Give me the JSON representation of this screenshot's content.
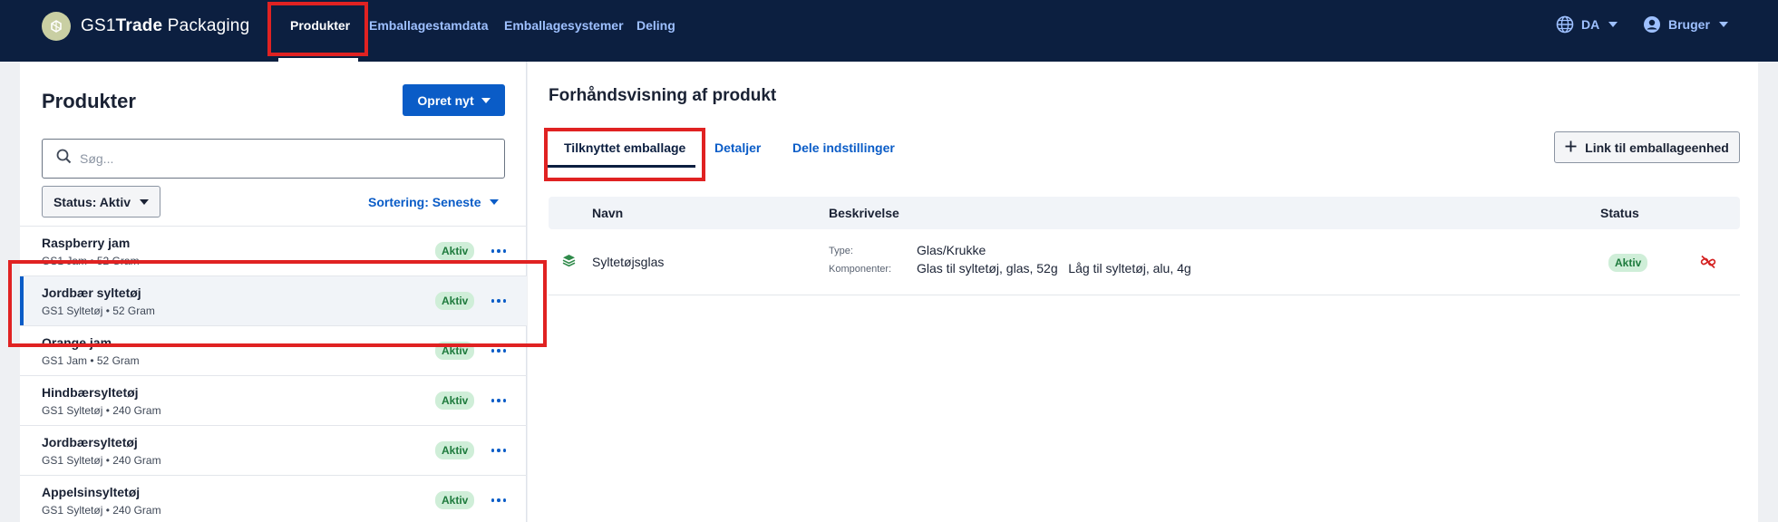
{
  "app": {
    "logo_text_regular1": "GS1",
    "logo_text_bold": "Trade",
    "logo_text_regular2": " Packaging"
  },
  "nav": {
    "items": [
      {
        "label": "Produkter",
        "active": true
      },
      {
        "label": "Emballagestamdata",
        "active": false
      },
      {
        "label": "Emballagesystemer",
        "active": false
      },
      {
        "label": "Deling",
        "active": false
      }
    ],
    "language": "DA",
    "user": "Bruger"
  },
  "products_panel": {
    "title": "Produkter",
    "create_button": "Opret nyt",
    "search_placeholder": "Søg...",
    "status_filter": "Status: Aktiv",
    "sort_label": "Sortering: Seneste",
    "items": [
      {
        "name": "Raspberry jam",
        "sub": "GS1 Jam • 52 Gram",
        "status": "Aktiv",
        "selected": false
      },
      {
        "name": "Jordbær syltetøj",
        "sub": "GS1 Syltetøj • 52 Gram",
        "status": "Aktiv",
        "selected": true
      },
      {
        "name": "Orange jam",
        "sub": "GS1 Jam • 52 Gram",
        "status": "Aktiv",
        "selected": false
      },
      {
        "name": "Hindbærsyltetøj",
        "sub": "GS1 Syltetøj • 240 Gram",
        "status": "Aktiv",
        "selected": false
      },
      {
        "name": "Jordbærsyltetøj",
        "sub": "GS1 Syltetøj • 240 Gram",
        "status": "Aktiv",
        "selected": false
      },
      {
        "name": "Appelsinsyltetøj",
        "sub": "GS1 Syltetøj • 240 Gram",
        "status": "Aktiv",
        "selected": false
      }
    ]
  },
  "preview": {
    "title": "Forhåndsvisning af produkt",
    "tabs": [
      {
        "label": "Tilknyttet emballage",
        "active": true
      },
      {
        "label": "Detaljer",
        "active": false
      },
      {
        "label": "Dele indstillinger",
        "active": false
      }
    ],
    "link_button": "Link til emballageenhed",
    "table": {
      "headers": {
        "name": "Navn",
        "description": "Beskrivelse",
        "status": "Status"
      },
      "rows": [
        {
          "name": "Syltetøjsglas",
          "type_label": "Type:",
          "type_value": "Glas/Krukke",
          "components_label": "Komponenter:",
          "components_value": "Glas til syltetøj, glas, 52g   Låg til syltetøj, alu, 4g",
          "status": "Aktiv"
        }
      ]
    }
  },
  "colors": {
    "topbar": "#0c1f40",
    "primary": "#0a5cc7",
    "badge_bg": "#cfeed8",
    "badge_text": "#1d7a3c",
    "highlight": "#e02222"
  },
  "icons": [
    "gs1-logo-icon",
    "globe-icon",
    "user-icon",
    "chevron-down-icon",
    "search-icon",
    "more-icon",
    "layers-icon",
    "plus-icon",
    "unlink-icon"
  ]
}
